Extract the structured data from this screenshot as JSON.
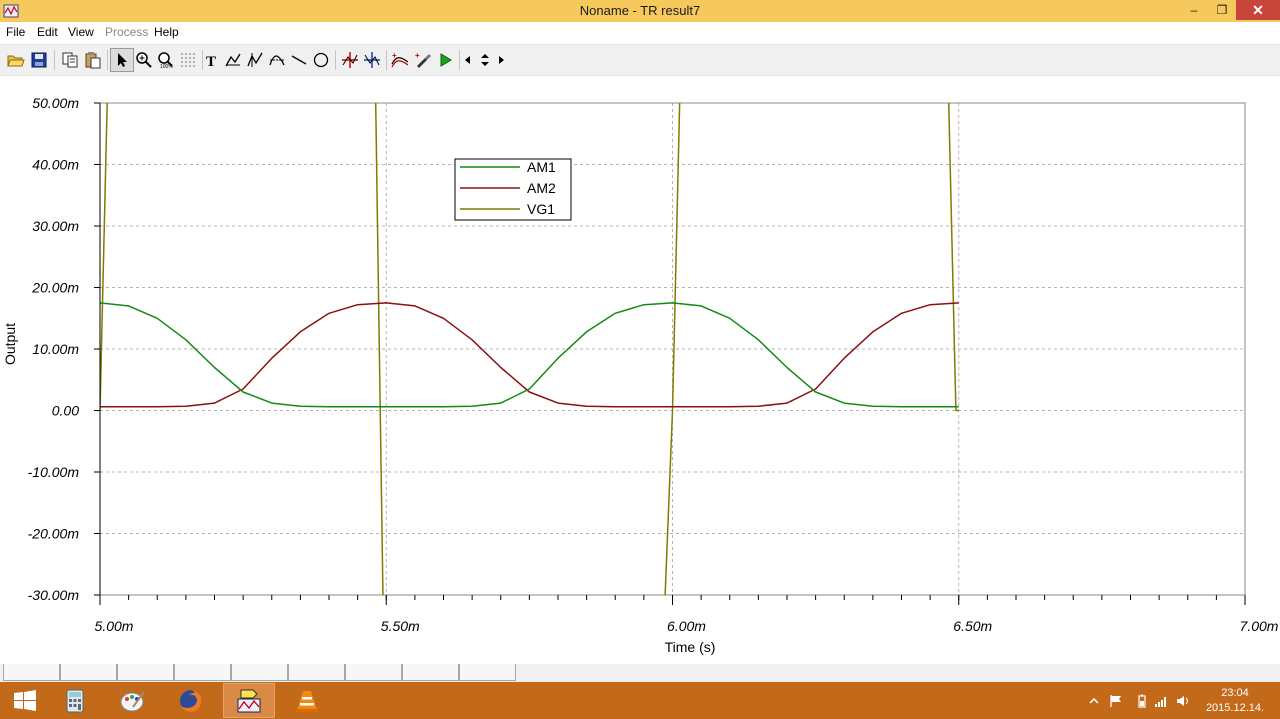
{
  "window": {
    "title": "Noname - TR result7",
    "controls": {
      "minimize": "‒",
      "maximize": "❐",
      "close": "✕"
    }
  },
  "menu": [
    {
      "label": "File",
      "enabled": true
    },
    {
      "label": "Edit",
      "enabled": true
    },
    {
      "label": "View",
      "enabled": true
    },
    {
      "label": "Process",
      "enabled": false
    },
    {
      "label": "Help",
      "enabled": true
    }
  ],
  "toolbar": [
    "open-folder-icon",
    "save-icon",
    "copy-icon",
    "paste-icon",
    "select-arrow-icon",
    "zoom-in-icon",
    "zoom-100-icon",
    "grid-icon",
    "text-icon",
    "cursor-a-icon",
    "cursor-b-icon",
    "cursor-c-icon",
    "line-tool-icon",
    "circle-tool-icon",
    "crosshair-red-icon",
    "crosshair-blue-icon",
    "add-curve-icon",
    "add-marker-icon",
    "run-icon",
    "scroll-left-icon",
    "scroll-updown-icon",
    "scroll-right-icon"
  ],
  "colors": {
    "AM1": "#148a14",
    "AM2": "#8b1010",
    "VG1": "#7f7c00",
    "titlebar": "#f6c95c",
    "taskbar": "#c36a1a"
  },
  "chart_data": {
    "type": "line",
    "xlabel": "Time (s)",
    "ylabel": "Output",
    "xlim": [
      0.005,
      0.007
    ],
    "ylim": [
      -0.03,
      0.05
    ],
    "x_ticks": [
      {
        "value": 0.005,
        "label": "5.00m"
      },
      {
        "value": 0.0055,
        "label": "5.50m"
      },
      {
        "value": 0.006,
        "label": "6.00m"
      },
      {
        "value": 0.0065,
        "label": "6.50m"
      },
      {
        "value": 0.007,
        "label": "7.00m"
      }
    ],
    "y_ticks": [
      {
        "value": 0.05,
        "label": "50.00m"
      },
      {
        "value": 0.04,
        "label": "40.00m"
      },
      {
        "value": 0.03,
        "label": "30.00m"
      },
      {
        "value": 0.02,
        "label": "20.00m"
      },
      {
        "value": 0.01,
        "label": "10.00m"
      },
      {
        "value": 0.0,
        "label": "0.00"
      },
      {
        "value": -0.01,
        "label": "-10.00m"
      },
      {
        "value": -0.02,
        "label": "-20.00m"
      },
      {
        "value": -0.03,
        "label": "-30.00m"
      }
    ],
    "grid": true,
    "legend_position": "top-center",
    "series": [
      {
        "name": "AM1",
        "x": [
          0.005,
          0.00505,
          0.0051,
          0.00515,
          0.0052,
          0.00525,
          0.0053,
          0.00535,
          0.0054,
          0.00545,
          0.0055,
          0.00555,
          0.0056,
          0.00565,
          0.0057,
          0.00575,
          0.0058,
          0.00585,
          0.0059,
          0.00595,
          0.006,
          0.00605,
          0.0061,
          0.00615,
          0.0062,
          0.00625,
          0.0063,
          0.00635,
          0.0064,
          0.00645,
          0.0065
        ],
        "y": [
          0.0175,
          0.017,
          0.015,
          0.0115,
          0.007,
          0.003,
          0.0012,
          0.0007,
          0.0006,
          0.0006,
          0.0006,
          0.0006,
          0.0006,
          0.0007,
          0.0012,
          0.0035,
          0.0085,
          0.0128,
          0.0158,
          0.0172,
          0.0175,
          0.017,
          0.015,
          0.0115,
          0.007,
          0.003,
          0.0012,
          0.0007,
          0.0006,
          0.0006,
          0.0006
        ]
      },
      {
        "name": "AM2",
        "x": [
          0.005,
          0.00505,
          0.0051,
          0.00515,
          0.0052,
          0.00525,
          0.0053,
          0.00535,
          0.0054,
          0.00545,
          0.0055,
          0.00555,
          0.0056,
          0.00565,
          0.0057,
          0.00575,
          0.0058,
          0.00585,
          0.0059,
          0.00595,
          0.006,
          0.00605,
          0.0061,
          0.00615,
          0.0062,
          0.00625,
          0.0063,
          0.00635,
          0.0064,
          0.00645,
          0.0065
        ],
        "y": [
          0.0006,
          0.0006,
          0.0006,
          0.0007,
          0.0012,
          0.0035,
          0.0085,
          0.0128,
          0.0158,
          0.0172,
          0.0175,
          0.017,
          0.015,
          0.0115,
          0.007,
          0.003,
          0.0012,
          0.0007,
          0.0006,
          0.0006,
          0.0006,
          0.0006,
          0.0006,
          0.0007,
          0.0012,
          0.0035,
          0.0085,
          0.0128,
          0.0158,
          0.0172,
          0.0175
        ]
      },
      {
        "name": "VG1",
        "x": [
          0.005,
          0.005015,
          0.00503,
          0.00548,
          0.005495,
          0.00551,
          0.005985,
          0.006,
          0.006015,
          0.00648,
          0.006495,
          0.0065
        ],
        "y": [
          0.0,
          0.06,
          0.06,
          0.06,
          -0.035,
          -0.035,
          -0.035,
          0.0,
          0.06,
          0.06,
          0.0,
          0.0
        ]
      }
    ]
  },
  "tabs_count": 9,
  "taskbar": {
    "apps": [
      "start-icon",
      "calculator-icon",
      "paint-icon",
      "firefox-icon",
      "tina-icon",
      "vlc-icon"
    ],
    "active_app": "tina-icon",
    "clock_time": "23:04",
    "clock_date": "2015.12.14."
  }
}
